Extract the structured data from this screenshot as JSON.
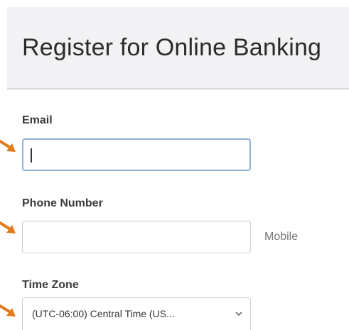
{
  "header": {
    "title": "Register for Online Banking"
  },
  "form": {
    "email": {
      "label": "Email",
      "value": ""
    },
    "phone": {
      "label": "Phone Number",
      "value": "",
      "suffix": "Mobile"
    },
    "timezone": {
      "label": "Time Zone",
      "selected": "(UTC-06:00) Central Time (US..."
    }
  },
  "colors": {
    "accent_arrow": "#e07b1f",
    "focus_border": "#8fb0d8",
    "header_bg": "#f2f2f4"
  },
  "icons": {
    "select_chevron": "chevron-down-icon",
    "pointer_arrows": "arrow-pointer-icon"
  }
}
